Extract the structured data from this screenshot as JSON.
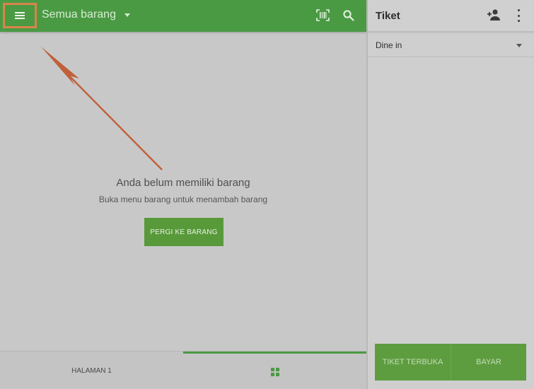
{
  "header": {
    "title": "Semua barang",
    "menu_icon": "hamburger-menu-icon",
    "barcode_icon": "barcode-scan-icon",
    "search_icon": "search-icon"
  },
  "empty_state": {
    "title": "Anda belum memiliki barang",
    "subtitle": "Buka menu barang untuk menambah barang",
    "button_label": "PERGI KE BARANG"
  },
  "bottom_tabs": {
    "page_label": "HALAMAN 1",
    "grid_icon": "grid-icon"
  },
  "ticket": {
    "title": "Tiket",
    "add_customer_icon": "add-person-icon",
    "more_icon": "more-vertical-icon",
    "dining_option": "Dine in",
    "open_tickets_label": "TIKET TERBUKA",
    "pay_label": "BAYAR"
  },
  "colors": {
    "primary_green": "#4a9a44",
    "button_green": "#589a3a",
    "highlight_orange": "#d9844a",
    "arrow_color": "#c0603a"
  }
}
